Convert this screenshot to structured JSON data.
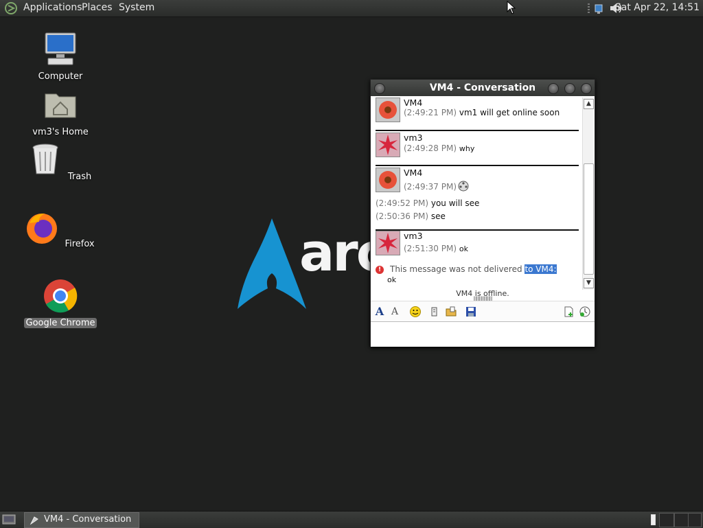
{
  "top_panel": {
    "menus": [
      "Applications",
      "Places",
      "System"
    ],
    "clock": "Sat Apr 22, 14:51"
  },
  "desktop": {
    "icons": [
      {
        "label": "Computer"
      },
      {
        "label": "vm3's Home"
      },
      {
        "label": "Trash"
      },
      {
        "label": "Firefox"
      },
      {
        "label": "Google Chrome"
      }
    ],
    "wallpaper_text": "arch"
  },
  "window": {
    "title": "VM4 - Conversation",
    "messages": [
      {
        "nick": "VM4",
        "time": "(2:49:21 PM)",
        "text": "vm1 will get online soon"
      },
      {
        "nick": "vm3",
        "time": "(2:49:28 PM)",
        "text": "why"
      },
      {
        "nick": "VM4",
        "time": "(2:49:37 PM)",
        "text": ""
      },
      {
        "time": "(2:49:52 PM)",
        "text": "you will see"
      },
      {
        "time": "(2:50:36 PM)",
        "text": "see"
      },
      {
        "nick": "vm3",
        "time": "(2:51:30 PM)",
        "text": "ok"
      }
    ],
    "error": {
      "text": "This message was not delivered",
      "highlight": "to VM4:",
      "body": "ok"
    },
    "status": "VM4 is offline."
  },
  "bottom_panel": {
    "task_label": "VM4 - Conversation"
  },
  "colors": {
    "panel": "#2f312f",
    "desktop": "#1f201f",
    "arch_blue": "#1793d1",
    "highlight": "#3b78d0"
  }
}
